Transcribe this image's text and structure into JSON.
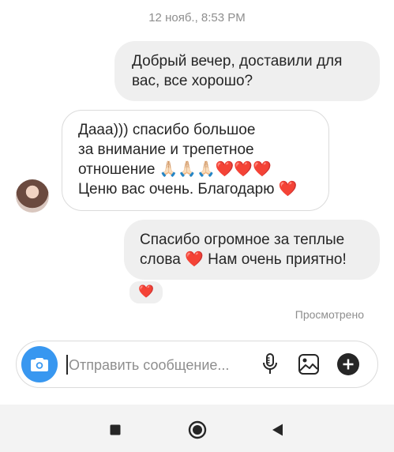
{
  "timestamp": "12 нояб., 8:53 PM",
  "messages": [
    {
      "direction": "outgoing",
      "lines": [
        "Добрый вечер, доставили для",
        "вас, все хорошо?"
      ]
    },
    {
      "direction": "incoming",
      "lines": [
        "Дааа))) спасибо большое",
        "за внимание и трепетное",
        "отношение",
        "Ценю вас очень. Благодарю"
      ]
    },
    {
      "direction": "outgoing",
      "lines": [
        "Спасибо огромное за теплые",
        "слова",
        "Нам очень приятно!"
      ]
    }
  ],
  "emoji": {
    "praying_hands": "🙏🏻🙏🏻🙏🏻",
    "three_hearts": "❤️❤️❤️",
    "heart": "❤️"
  },
  "reaction": "❤️",
  "seen_status": "Просмотрено",
  "composer": {
    "placeholder": "Отправить сообщение..."
  },
  "colors": {
    "accent": "#3897f0",
    "heart": "#e0262d"
  },
  "icons": {
    "camera": "camera-icon",
    "mic": "microphone-icon",
    "gallery": "image-icon",
    "plus": "plus-icon",
    "nav_recents": "square-icon",
    "nav_home": "circle-icon",
    "nav_back": "triangle-back-icon"
  }
}
